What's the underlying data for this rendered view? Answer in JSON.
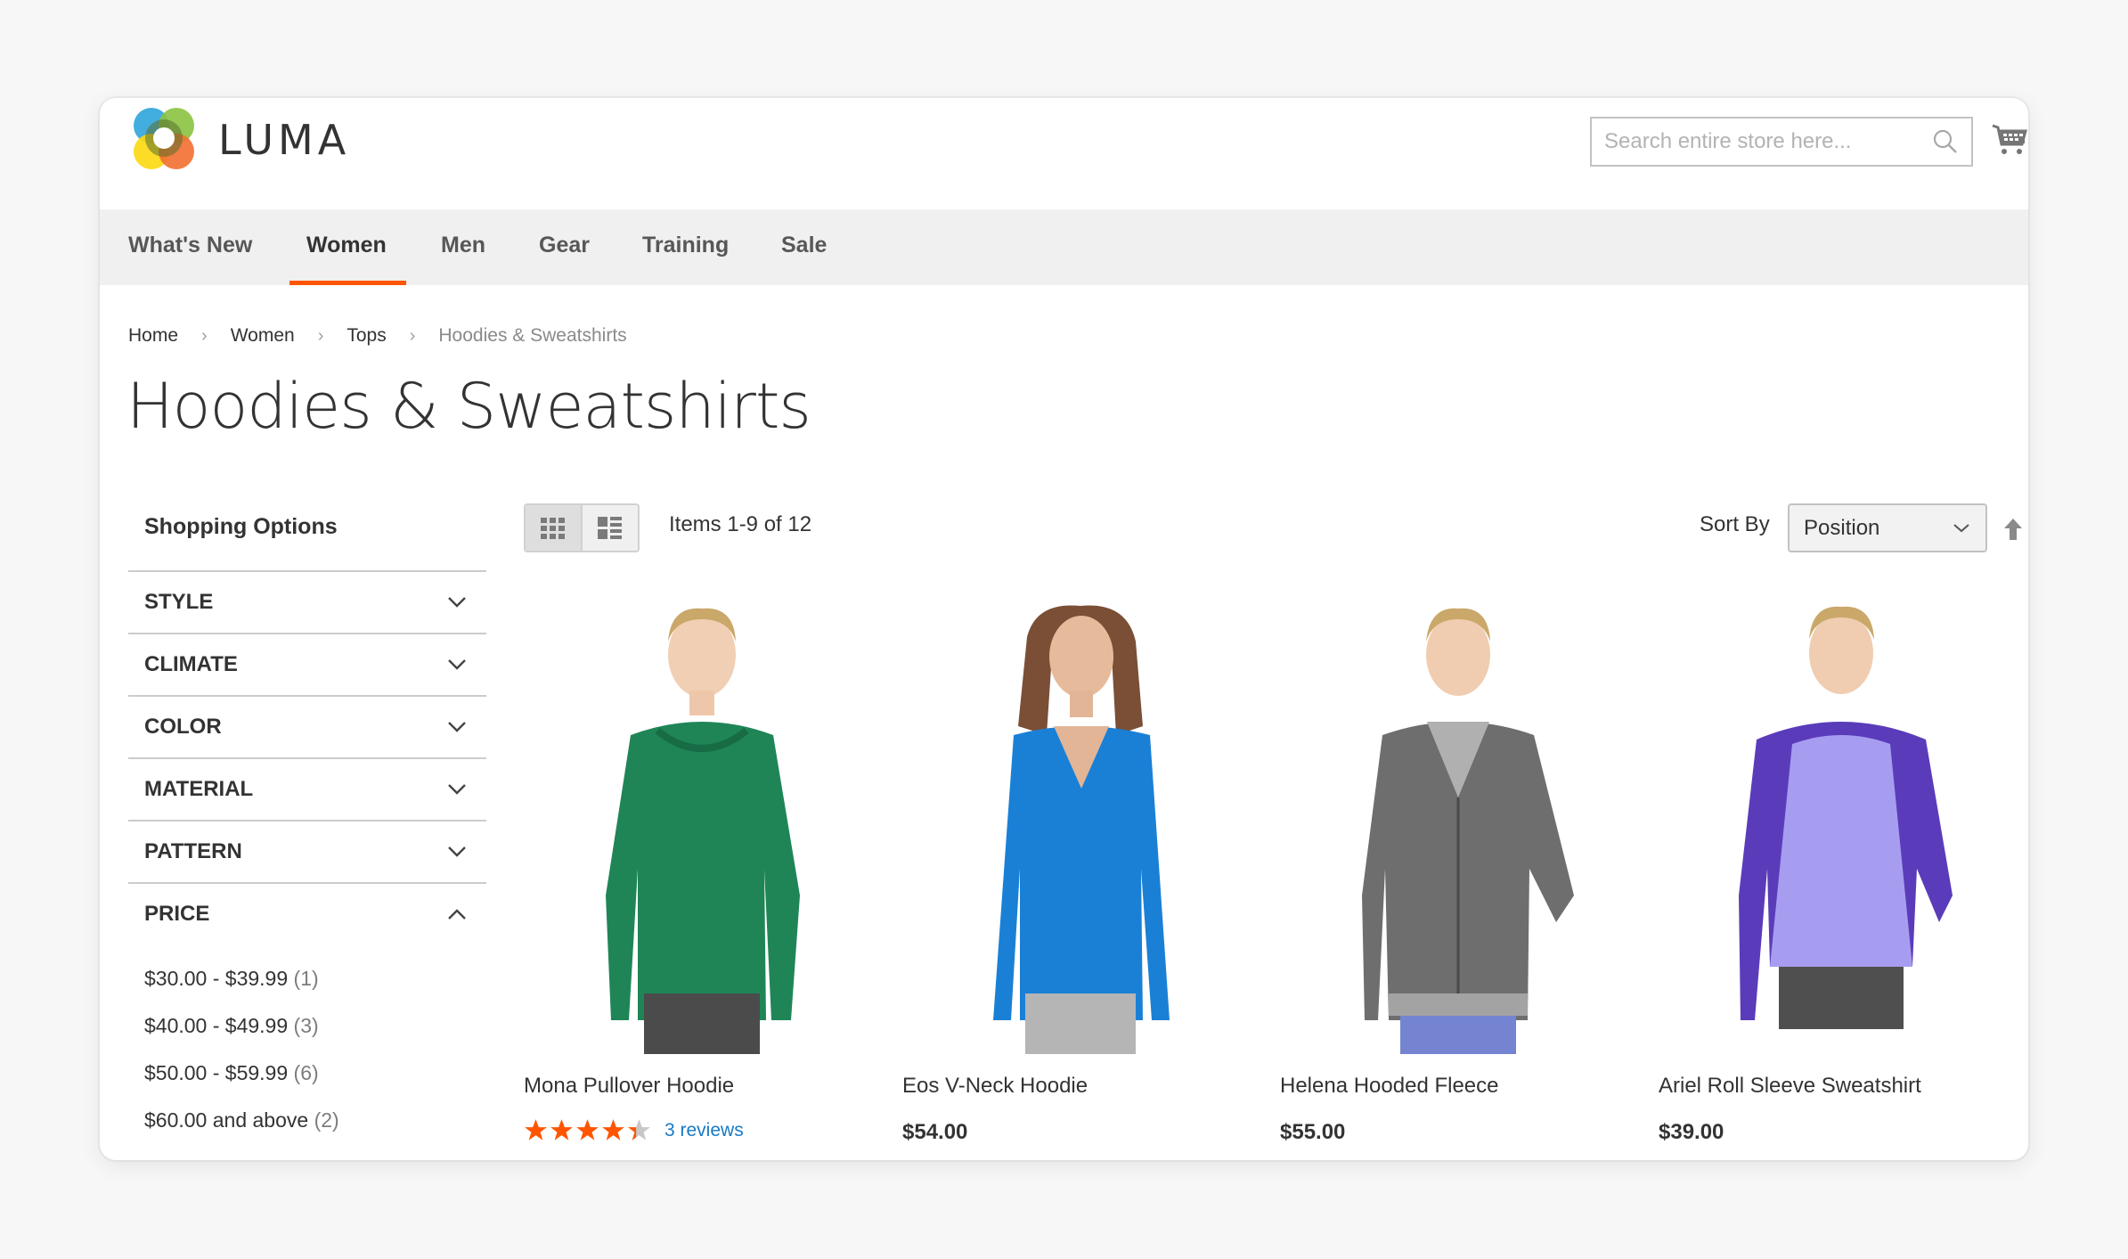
{
  "brand": {
    "name": "LUMA",
    "logo_icon": "luma-flower-logo"
  },
  "header": {
    "search_placeholder": "Search entire store here...",
    "search_icon": "search-icon",
    "cart_icon": "shopping-cart-icon"
  },
  "nav": {
    "items": [
      {
        "label": "What's New",
        "active": false
      },
      {
        "label": "Women",
        "active": true
      },
      {
        "label": "Men",
        "active": false
      },
      {
        "label": "Gear",
        "active": false
      },
      {
        "label": "Training",
        "active": false
      },
      {
        "label": "Sale",
        "active": false
      }
    ],
    "accent_color": "#ff5501"
  },
  "breadcrumb": {
    "items": [
      "Home",
      "Women",
      "Tops",
      "Hoodies & Sweatshirts"
    ],
    "separator": "›"
  },
  "page_title": "Hoodies & Sweatshirts",
  "sidebar": {
    "title": "Shopping Options",
    "filters": [
      {
        "label": "STYLE",
        "expanded": false
      },
      {
        "label": "CLIMATE",
        "expanded": false
      },
      {
        "label": "COLOR",
        "expanded": false
      },
      {
        "label": "MATERIAL",
        "expanded": false
      },
      {
        "label": "PATTERN",
        "expanded": false
      },
      {
        "label": "PRICE",
        "expanded": true
      }
    ],
    "price_options": [
      {
        "label": "$30.00 - $39.99",
        "count": "(1)"
      },
      {
        "label": "$40.00 - $49.99",
        "count": "(3)"
      },
      {
        "label": "$50.00 - $59.99",
        "count": "(6)"
      },
      {
        "label": "$60.00 and above",
        "count": "(2)"
      }
    ]
  },
  "toolbar": {
    "view_modes": [
      "grid",
      "list"
    ],
    "active_view": "grid",
    "items_count": "Items 1-9 of 12",
    "sort_label": "Sort By",
    "sort_value": "Position",
    "sort_direction_icon": "arrow-up-icon"
  },
  "products": [
    {
      "name": "Mona Pullover Hoodie",
      "price": null,
      "rating_stars": 4.3,
      "rating_max": 5,
      "reviews": "3 reviews",
      "color": "#1f8557"
    },
    {
      "name": "Eos V-Neck Hoodie",
      "price": "$54.00",
      "color": "#1a80d6"
    },
    {
      "name": "Helena Hooded Fleece",
      "price": "$55.00",
      "color": "#6e6e6e"
    },
    {
      "name": "Ariel Roll Sleeve Sweatshirt",
      "price": "$39.00",
      "color": "#a79df0"
    }
  ],
  "colors": {
    "star_filled": "#ff5501",
    "star_empty": "#c7c7c7",
    "link": "#1979c3"
  }
}
